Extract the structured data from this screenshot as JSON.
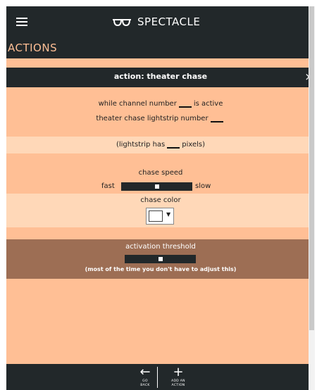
{
  "app": {
    "brand_title": "SPECTACLE",
    "section_title": "ACTIONS"
  },
  "card": {
    "header": "action: theater chase",
    "close_glyph": "×",
    "line1": {
      "pre": "while channel number",
      "post": "is active"
    },
    "line2": {
      "pre": "theater chase lightstrip number"
    },
    "pixels": {
      "pre": "(lightstrip has",
      "post": "pixels)"
    },
    "speed": {
      "label": "chase speed",
      "left": "fast",
      "right": "slow",
      "value_pct": 50
    },
    "color": {
      "label": "chase color",
      "value": "#ffffff"
    },
    "threshold": {
      "label": "activation threshold",
      "note": "(most of the time you don't have to adjust this)",
      "value_pct": 50
    }
  },
  "bottom_nav": {
    "back": {
      "icon": "back-arrow-icon",
      "glyph": "←",
      "line1": "GO",
      "line2": "BACK"
    },
    "add": {
      "icon": "plus-icon",
      "glyph": "+",
      "line1": "ADD AN",
      "line2": "ACTION"
    }
  },
  "colors": {
    "dark": "#22282a",
    "accent": "#ffbf95",
    "band": "#ffd8b8",
    "threshold_bg": "#9d6e54"
  }
}
